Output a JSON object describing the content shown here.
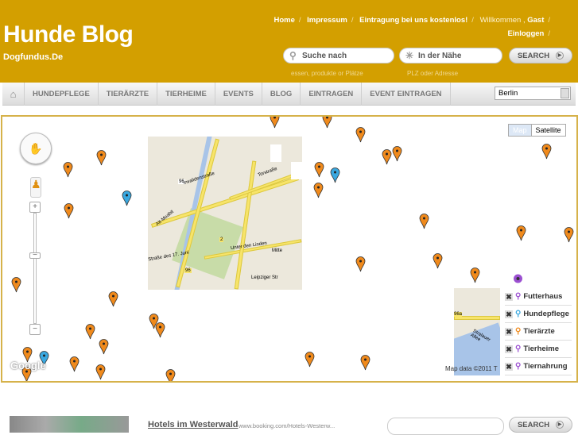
{
  "header": {
    "title": "Hunde Blog",
    "subtitle": "Dogfundus.De",
    "links": {
      "home": "Home",
      "impressum": "Impressum",
      "eintragung": "Eintragung bei uns kostenlos!",
      "welcome": "Willkommen ,",
      "user": "Gast",
      "login": "Einloggen"
    },
    "search": {
      "what_placeholder": "Suche nach",
      "what_hint": "essen, produkte or Plätze",
      "where_placeholder": "In der Nähe",
      "where_hint": "PLZ oder Adresse",
      "button": "SEARCH"
    }
  },
  "nav": {
    "items": [
      "HUNDEPFLEGE",
      "TIERÄRZTE",
      "TIERHEIME",
      "EVENTS",
      "BLOG",
      "EINTRAGEN",
      "EVENT EINTRAGEN"
    ],
    "city": "Berlin"
  },
  "map": {
    "type_buttons": [
      "Map",
      "Satellite"
    ],
    "google": "Google",
    "copyright": "Map data ©2011 T",
    "labels": {
      "r96": "96",
      "r2": "2",
      "linden": "Unter den Linden",
      "mitte": "Mitte",
      "str17": "Straße des 17. Juni",
      "leipziger": "Leipziger Str",
      "invaliden": "Invalidenstraße",
      "tor": "Torstraße",
      "moabit": "Alt-Moabit",
      "r96a": "96a",
      "stralauer": "Stralauer Allee"
    },
    "legend": [
      {
        "label": "Futterhaus",
        "color": "#9b4fd1"
      },
      {
        "label": "Hundepflege",
        "color": "#3aa8e0"
      },
      {
        "label": "Tierärzte",
        "color": "#f08a1c"
      },
      {
        "label": "Tierheime",
        "color": "#9b4fd1"
      },
      {
        "label": "Tiernahrung",
        "color": "#9b4fd1"
      }
    ],
    "colors": {
      "orange": "#f08a1c",
      "blue": "#3aa8e0",
      "purple": "#9b4fd1"
    }
  },
  "ad": {
    "link": "Hotels im Westerwald",
    "url": "www.booking.com/Hotels-Westerw...",
    "button": "SEARCH"
  }
}
